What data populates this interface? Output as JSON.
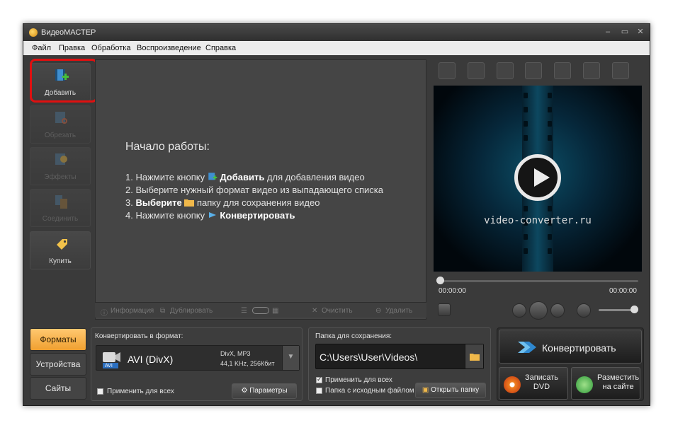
{
  "window": {
    "title": "ВидеоМАСТЕР",
    "controls": [
      "‒",
      "▭",
      "✕"
    ]
  },
  "menu": [
    "Файл",
    "Правка",
    "Обработка",
    "Воспроизведение",
    "Справка"
  ],
  "toolbar": {
    "add": "Добавить",
    "cut": "Обрезать",
    "effects": "Эффекты",
    "join": "Соединить",
    "buy": "Купить"
  },
  "intro": {
    "heading": "Начало работы:",
    "step1_pre": "1. Нажмите кнопку",
    "step1_bold": "Добавить",
    "step1_post": "для добавления видео",
    "step2": "2. Выберите нужный формат видео из выпадающего списка",
    "step3_pre": "3.",
    "step3_bold": "Выберите",
    "step3_post": "папку для сохранения видео",
    "step4_pre": "4. Нажмите кнопку",
    "step4_bold": "Конвертировать"
  },
  "infobar": {
    "info": "Информация",
    "duplicate": "Дублировать",
    "clear": "Очистить",
    "delete": "Удалить"
  },
  "preview": {
    "watermark": "video-converter.ru",
    "time_start": "00:00:00",
    "time_end": "00:00:00",
    "progress": 0,
    "volume": 0.9
  },
  "tabs": {
    "formats": "Форматы",
    "devices": "Устройства",
    "sites": "Сайты"
  },
  "format": {
    "label": "Конвертировать в формат:",
    "name": "AVI (DivX)",
    "badge": "AVI",
    "detail1": "DivX, MP3",
    "detail2": "44,1 KHz, 256Кбит",
    "apply_all": "Применить для всех",
    "params": "Параметры"
  },
  "save": {
    "label": "Папка для сохранения:",
    "path": "C:\\Users\\User\\Videos\\",
    "apply_all": "Применить для всех",
    "source_folder": "Папка с исходным файлом",
    "open": "Открыть папку"
  },
  "actions": {
    "convert": "Конвертировать",
    "dvd_line1": "Записать",
    "dvd_line2": "DVD",
    "web_line1": "Разместить",
    "web_line2": "на сайте"
  },
  "colors": {
    "accent": "#f5a623",
    "highlight": "#e01010",
    "bg": "#3a3a3a"
  }
}
